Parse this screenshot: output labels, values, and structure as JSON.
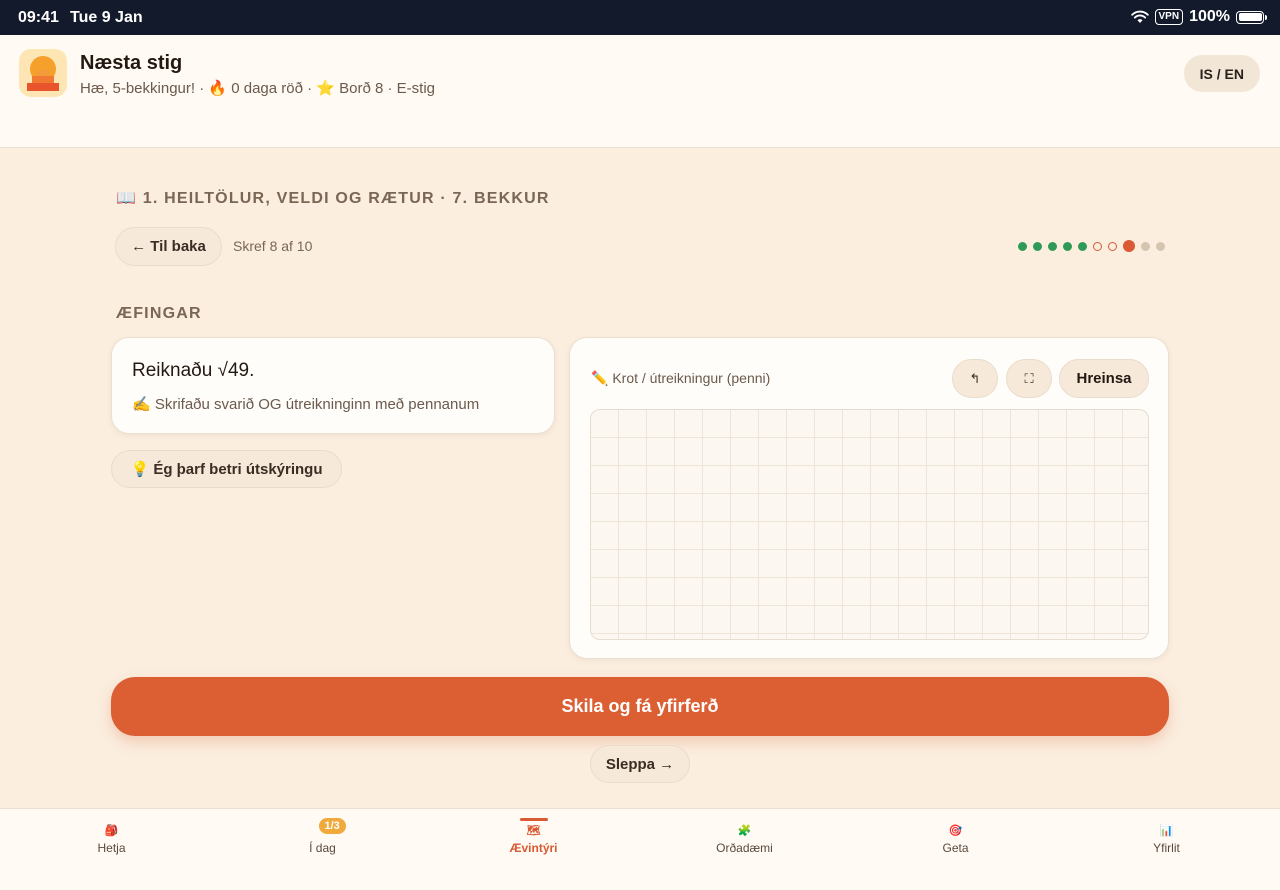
{
  "status_bar": {
    "time": "09:41",
    "date": "Tue 9 Jan",
    "vpn": "VPN",
    "battery": "100%"
  },
  "header": {
    "title": "Næsta stig",
    "subtitle": "Hæ, 5-bekkingur! · 🔥 0 daga röð · ⭐ Borð 8 · E-stig",
    "language_toggle": "IS / EN",
    "logo_icon": "stairs-sunrise-logo"
  },
  "lesson": {
    "breadcrumb": "📖 1. HEILTÖLUR, VELDI OG RÆTUR · 7. BEKKUR",
    "back_label": "← Til baka",
    "step_text": "Skref 8 af 10",
    "progress": {
      "total_steps": 10,
      "current_step": 8,
      "states": [
        "done",
        "done",
        "done",
        "done",
        "done",
        "miss",
        "miss",
        "current",
        "todo",
        "todo"
      ],
      "colors": {
        "done": "#2f9a57",
        "miss": "#d95a33",
        "current": "#d95a33",
        "todo": "#d4c4b0"
      }
    }
  },
  "exercise": {
    "section_label": "ÆFINGAR",
    "question": "Reiknaðu √49.",
    "instruction": "✍️ Skrifaðu svarið OG útreikninginn með pennanum",
    "explain_button": "💡 Ég þarf betri útskýringu"
  },
  "scratchpad": {
    "label": "✏️ Krot / útreikningur (penni)",
    "undo_icon": "↰",
    "expand_icon": "⛶",
    "clear_label": "Hreinsa"
  },
  "actions": {
    "submit_label": "Skila og fá yfirferð",
    "skip_label": "Sleppa →",
    "accent_color": "#dc5e33"
  },
  "tabs": [
    {
      "label": "Hetja",
      "icon": "backpack-icon",
      "glyph": "🎒",
      "active": false
    },
    {
      "label": "Í dag",
      "icon": "calendar-icon",
      "glyph": "",
      "badge": "1/3",
      "active": false
    },
    {
      "label": "Ævintýri",
      "icon": "map-icon",
      "glyph": "🗺",
      "active": true
    },
    {
      "label": "Orðadæmi",
      "icon": "blocks-icon",
      "glyph": "🧩",
      "active": false
    },
    {
      "label": "Geta",
      "icon": "target-icon",
      "glyph": "🎯",
      "active": false
    },
    {
      "label": "Yfirlit",
      "icon": "bar-chart-icon",
      "glyph": "📊",
      "active": false
    }
  ]
}
